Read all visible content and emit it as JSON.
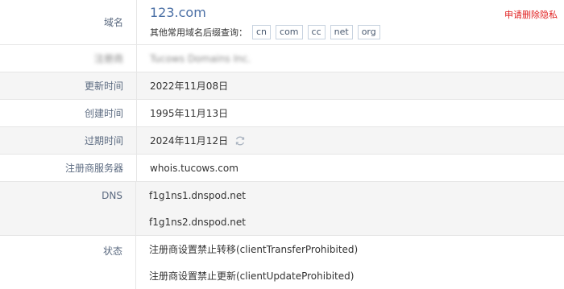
{
  "domain": {
    "label": "域名",
    "name": "123.com",
    "privacy_link": "申请删除隐私",
    "suffix_prompt": "其他常用域名后缀查询：",
    "suffixes": [
      "cn",
      "com",
      "cc",
      "net",
      "org"
    ]
  },
  "registrar": {
    "label": "注册商",
    "value": "Tucows Domains Inc."
  },
  "updated": {
    "label": "更新时间",
    "value": "2022年11月08日"
  },
  "created": {
    "label": "创建时间",
    "value": "1995年11月13日"
  },
  "expires": {
    "label": "过期时间",
    "value": "2024年11月12日",
    "refresh_icon": "refresh-icon"
  },
  "whois_server": {
    "label": "注册商服务器",
    "value": "whois.tucows.com"
  },
  "dns": {
    "label": "DNS",
    "servers": [
      "f1g1ns1.dnspod.net",
      "f1g1ns2.dnspod.net"
    ]
  },
  "status": {
    "label": "状态",
    "items": [
      "注册商设置禁止转移(clientTransferProhibited)",
      "注册商设置禁止更新(clientUpdateProhibited)"
    ]
  },
  "colors": {
    "accent": "#4a6fa5",
    "link_red": "#e02020",
    "row_alt": "#f5f5f5",
    "label": "#5b6a80"
  }
}
